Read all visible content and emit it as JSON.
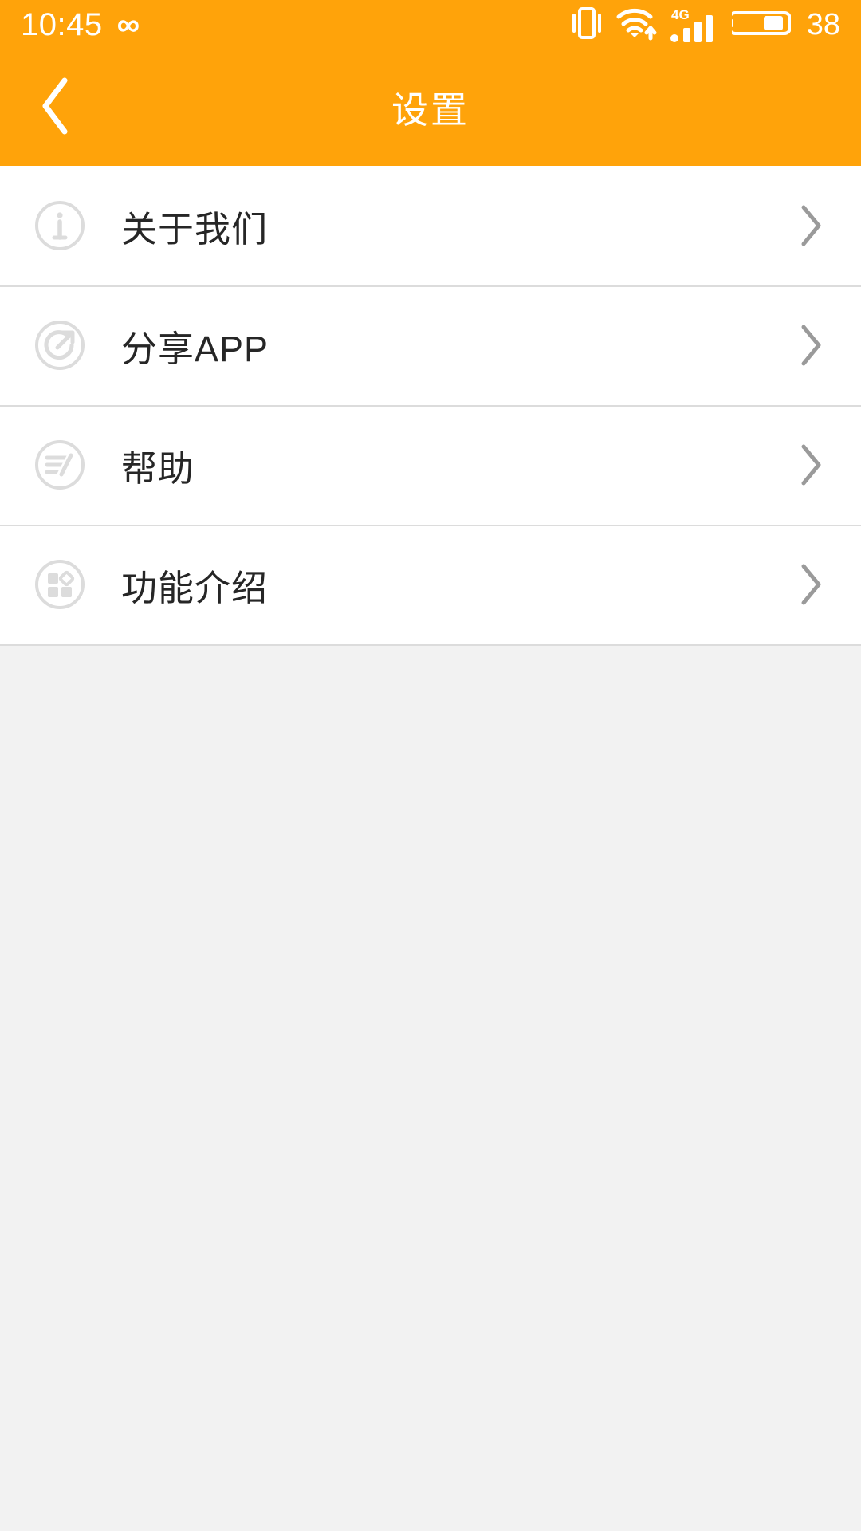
{
  "theme": {
    "brand_orange": "#FFA30A",
    "list_bg": "#FFFFFF",
    "page_bg": "#F2F2F2",
    "label_color": "#262626",
    "icon_gray": "#DCDCDC",
    "chevron_gray": "#9A9A9A",
    "divider": "#DCDCDC"
  },
  "statusbar": {
    "time": "10:45",
    "infinity_glyph": "∞",
    "icons": [
      "vibrate-icon",
      "wifi-icon",
      "signal-4g-icon",
      "battery-icon"
    ],
    "network_type": "4G",
    "battery_percent": "38",
    "signal_bars": 3,
    "wifi_bars": 3
  },
  "header": {
    "title": "设置",
    "back_icon": "chevron-left-icon"
  },
  "list": {
    "items": [
      {
        "label": "关于我们",
        "icon": "info-circle-icon",
        "chevron": "chevron-right-icon"
      },
      {
        "label": "分享APP",
        "icon": "share-circle-icon",
        "chevron": "chevron-right-icon"
      },
      {
        "label": "帮助",
        "icon": "help-lines-icon",
        "chevron": "chevron-right-icon"
      },
      {
        "label": "功能介绍",
        "icon": "features-grid-icon",
        "chevron": "chevron-right-icon"
      }
    ]
  }
}
